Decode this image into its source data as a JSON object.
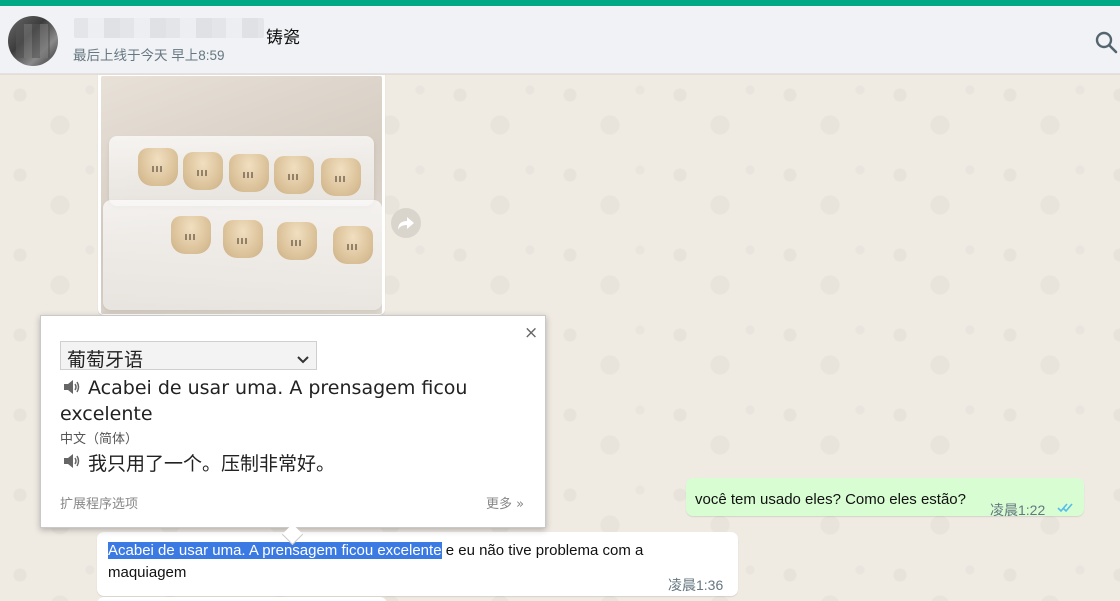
{
  "header": {
    "contact_name": "铸瓷",
    "last_seen": "最后上线于今天 早上8:59",
    "search_icon": "search-icon"
  },
  "colors": {
    "accent": "#00a884",
    "outgoing_bubble": "#d9fdd3",
    "incoming_bubble": "#ffffff",
    "highlight": "#3b7ae3",
    "read_ticks": "#53bdeb"
  },
  "messages": {
    "outgoing": {
      "text": "você tem usado eles? Como eles estão?",
      "time": "凌晨1:22"
    },
    "incoming": {
      "highlighted": "Acabei de usar uma. A prensagem ficou excelente",
      "rest": " e eu não tive problema com a maquiagem",
      "time": "凌晨1:36"
    }
  },
  "translator": {
    "source_lang": "葡萄牙语",
    "source_text": "Acabei de usar uma. A prensagem ficou excelente",
    "target_lang": "中文（简体）",
    "target_text": "我只用了一个。压制非常好。",
    "close": "×",
    "extension_options": "扩展程序选项",
    "more": "更多 »"
  }
}
